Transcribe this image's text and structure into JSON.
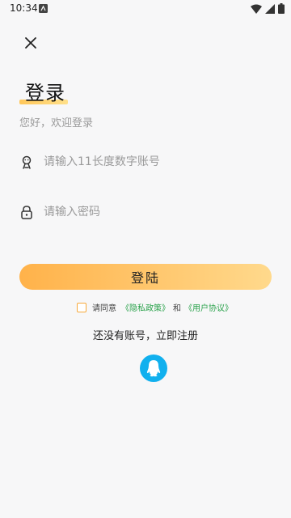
{
  "status_bar": {
    "time": "10:34",
    "notification_icon": "android-notification-icon",
    "wifi_icon": "wifi-icon",
    "signal_icon": "signal-icon",
    "battery_icon": "battery-icon"
  },
  "header": {
    "close_icon": "close-icon",
    "title": "登录",
    "subtitle": "您好，欢迎登录"
  },
  "form": {
    "account": {
      "icon": "user-icon",
      "placeholder": "请输入11长度数字账号",
      "value": ""
    },
    "password": {
      "icon": "lock-icon",
      "placeholder": "请输入密码",
      "value": ""
    },
    "login_label": "登陆"
  },
  "agreement": {
    "checked": false,
    "prefix": "请同意",
    "privacy_link": "《隐私政策》",
    "and": "和",
    "user_agreement_link": "《用户协议》"
  },
  "register_link": "还没有账号，立即注册",
  "social_login": {
    "qq_icon": "qq-icon"
  },
  "colors": {
    "accent_start": "#ffb24a",
    "accent_end": "#ffd98c",
    "link_green": "#2aa24b",
    "qq_blue": "#11b0ee"
  }
}
